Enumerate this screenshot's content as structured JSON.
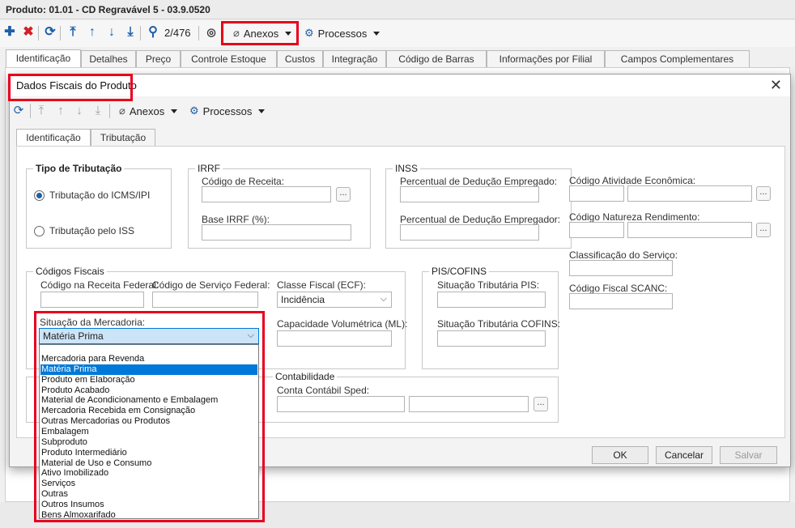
{
  "window": {
    "title": "Produto: 01.01 - CD Regravável 5 - 03.9.0520"
  },
  "toolbar": {
    "record_counter": "2/476",
    "anexos_label": "Anexos",
    "processos_label": "Processos"
  },
  "outer_tabs": [
    {
      "label": "Identificação"
    },
    {
      "label": "Detalhes"
    },
    {
      "label": "Preço"
    },
    {
      "label": "Controle Estoque"
    },
    {
      "label": "Custos"
    },
    {
      "label": "Integração"
    },
    {
      "label": "Código de Barras"
    },
    {
      "label": "Informações por Filial"
    },
    {
      "label": "Campos Complementares"
    }
  ],
  "dialog": {
    "title": "Dados Fiscais do Produto",
    "close_glyph": "✕",
    "toolbar": {
      "anexos_label": "Anexos",
      "processos_label": "Processos"
    },
    "tabs": [
      {
        "label": "Identificação"
      },
      {
        "label": "Tributação"
      }
    ],
    "tipo_tributacao": {
      "title": "Tipo de Tributação",
      "option_icms": "Tributação do ICMS/IPI",
      "option_iss": "Tributação pelo ISS",
      "selected": "Tributação do ICMS/IPI"
    },
    "irrf": {
      "title": "IRRF",
      "codigo_receita_label": "Código de Receita:",
      "base_label": "Base IRRF (%):"
    },
    "inss": {
      "title": "INSS",
      "empregado_label": "Percentual de Dedução Empregado:",
      "empregador_label": "Percentual de Dedução Empregador:"
    },
    "right_fields": {
      "atividade_label": "Código Atividade Econômica:",
      "natureza_label": "Código Natureza Rendimento:",
      "classificacao_label": "Classificação do Serviço:",
      "scanc_label": "Código Fiscal SCANC:"
    },
    "codigos_fiscais": {
      "title": "Códigos Fiscais",
      "receita_federal_label": "Código na Receita Federal:",
      "servico_federal_label": "Código de Serviço Federal:",
      "classe_fiscal_label": "Classe Fiscal (ECF):",
      "classe_fiscal_value": "Incidência",
      "capacidade_label": "Capacidade Volumétrica (ML):",
      "situacao_label": "Situação da Mercadoria:",
      "situacao_value": "Matéria Prima"
    },
    "pis_cofins": {
      "title": "PIS/COFINS",
      "pis_label": "Situação Tributária PIS:",
      "cofins_label": "Situação Tributária COFINS:"
    },
    "contabilidade": {
      "title": "Contabilidade",
      "conta_label": "Conta Contábil Sped:"
    },
    "buttons": {
      "ok": "OK",
      "cancel": "Cancelar",
      "save": "Salvar"
    }
  },
  "situacao_options": [
    "Mercadoria para Revenda",
    "Matéria Prima",
    "Produto em Elaboração",
    "Produto Acabado",
    "Material de Acondicionamento e Embalagem",
    "Mercadoria Recebida em Consignação",
    "Outras Mercadorias ou Produtos",
    "Embalagem",
    "Subproduto",
    "Produto Intermediário",
    "Material de Uso e Consumo",
    "Ativo Imobilizado",
    "Serviços",
    "Outras",
    "Outros Insumos",
    "Bens Almoxarifado"
  ],
  "colors": {
    "highlight": "#e8001c",
    "accent": "#1e5fa8",
    "selection": "#0078d7"
  }
}
